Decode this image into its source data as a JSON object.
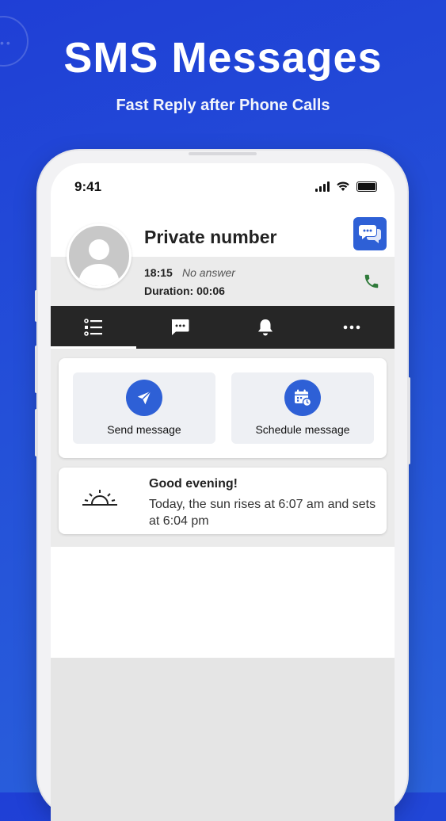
{
  "hero": {
    "title": "SMS Messages",
    "subtitle": "Fast Reply after Phone Calls"
  },
  "status_bar": {
    "time": "9:41"
  },
  "contact": {
    "name": "Private number",
    "call_time": "18:15",
    "call_status": "No answer",
    "duration": "Duration: 00:06"
  },
  "tabs": [
    {
      "icon": "list-icon",
      "active": true
    },
    {
      "icon": "message-icon",
      "active": false
    },
    {
      "icon": "bell-icon",
      "active": false
    },
    {
      "icon": "more-icon",
      "active": false
    }
  ],
  "actions": {
    "send_label": "Send message",
    "schedule_label": "Schedule message"
  },
  "greeting": {
    "title": "Good evening!",
    "text": "Today, the sun rises at 6:07 am and sets at 6:04 pm"
  },
  "colors": {
    "background": "#2450d8",
    "accent": "#2e60d6",
    "tabbar": "#262626",
    "call_green": "#2f7a3a"
  }
}
